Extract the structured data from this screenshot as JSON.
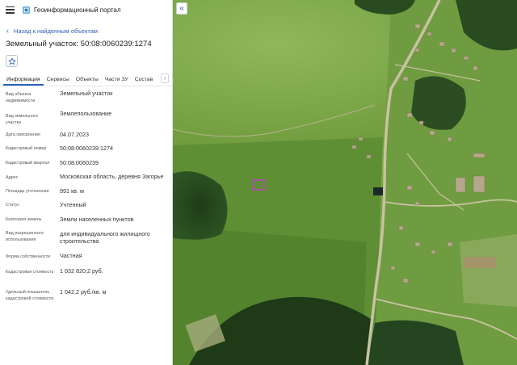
{
  "header": {
    "app_title": "Геоинформационный портал",
    "menu_icon": "hamburger-icon",
    "logo_icon": "portal-logo-icon"
  },
  "back_link": {
    "label": "Назад к найденным объектам"
  },
  "object": {
    "title": "Земельный участок: 50:08:0060239:1274"
  },
  "tabs": [
    {
      "label": "Информация",
      "active": true
    },
    {
      "label": "Сервисы"
    },
    {
      "label": "Объекты"
    },
    {
      "label": "Части ЗУ"
    },
    {
      "label": "Состав"
    }
  ],
  "attributes": [
    {
      "label": "Вид объекта недвижимости",
      "value": "Земельный участок"
    },
    {
      "label": "Вид земельного участка",
      "value": "Землепользование"
    },
    {
      "label": "Дата присвоения",
      "value": "04.07.2023"
    },
    {
      "label": "Кадастровый номер",
      "value": "50:08:0060239:1274"
    },
    {
      "label": "Кадастровый квартал",
      "value": "50:08:0060239"
    },
    {
      "label": "Адрес",
      "value": "Московская область, деревня Загорье"
    },
    {
      "label": "Площадь уточненная",
      "value": "991 кв. м"
    },
    {
      "label": "Статус",
      "value": "Учтенный"
    },
    {
      "label": "Категория земель",
      "value": "Земли населенных пунктов"
    },
    {
      "label": "Вид разрешенного использования",
      "value": "для индивидуального жилищного строительства"
    },
    {
      "label": "Форма собственности",
      "value": "Частная"
    },
    {
      "label": "Кадастровая стоимость",
      "value": "1 032 820,2 руб."
    },
    {
      "label": "Удельный показатель кадастровой стоимости",
      "value": "1 042,2 руб./кв. м"
    }
  ],
  "colors": {
    "accent": "#2a63b8",
    "parcel": "#c23fd0"
  }
}
